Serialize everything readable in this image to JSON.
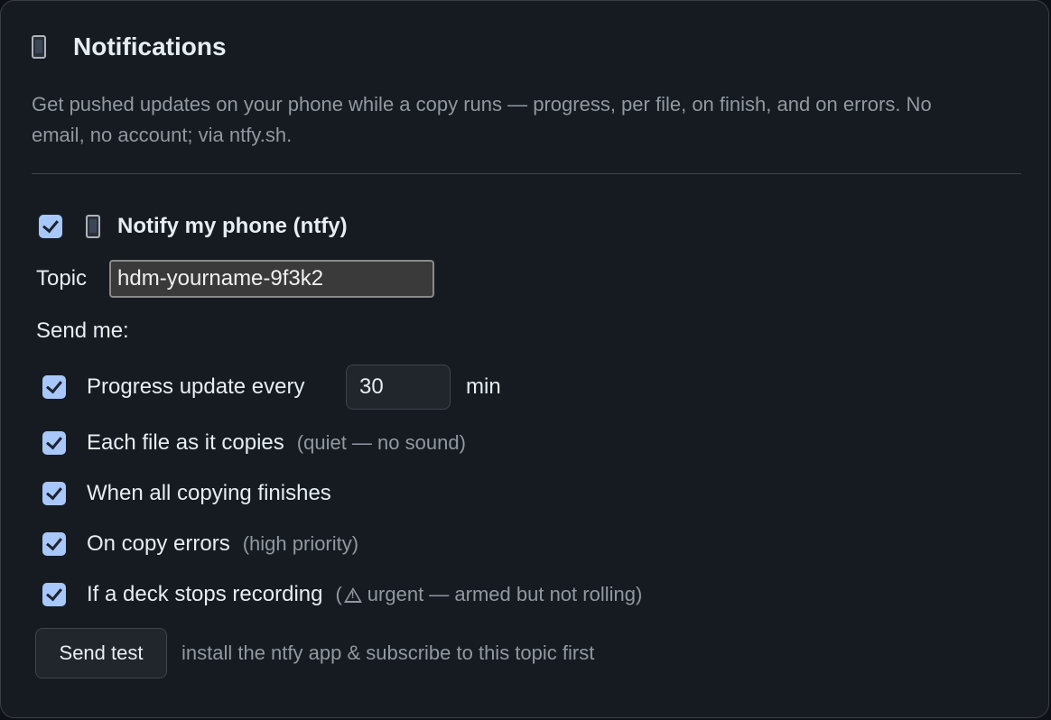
{
  "card": {
    "title": "Notifications",
    "title_icon": "mobile-phone-icon",
    "description": "Get pushed updates on your phone while a copy runs — progress, per file, on finish, and on errors. No email, no account; via ntfy.sh."
  },
  "enable": {
    "checked": true,
    "icon": "mobile-phone-icon",
    "label": "Notify my phone (ntfy)"
  },
  "topic": {
    "label": "Topic",
    "value": "hdm-yourname-9f3k2"
  },
  "send_me_label": "Send me:",
  "options": {
    "progress": {
      "checked": true,
      "label": "Progress update every",
      "interval_value": "30",
      "unit": "min"
    },
    "each_file": {
      "checked": true,
      "label": "Each file as it copies",
      "note": "(quiet — no sound)"
    },
    "finish": {
      "checked": true,
      "label": "When all copying finishes"
    },
    "errors": {
      "checked": true,
      "label": "On copy errors",
      "note": "(high priority)"
    },
    "deck_stop": {
      "checked": true,
      "label": "If a deck stops recording",
      "note_open": "(",
      "note_icon": "warning-icon",
      "note_text": "urgent — armed but not rolling)"
    }
  },
  "test": {
    "button_label": "Send test",
    "hint": "install the ntfy app & subscribe to this topic first"
  },
  "colors": {
    "background": "#161b22",
    "text": "#e6edf3",
    "muted": "#9198a1",
    "checkbox": "#a8c7fa"
  }
}
